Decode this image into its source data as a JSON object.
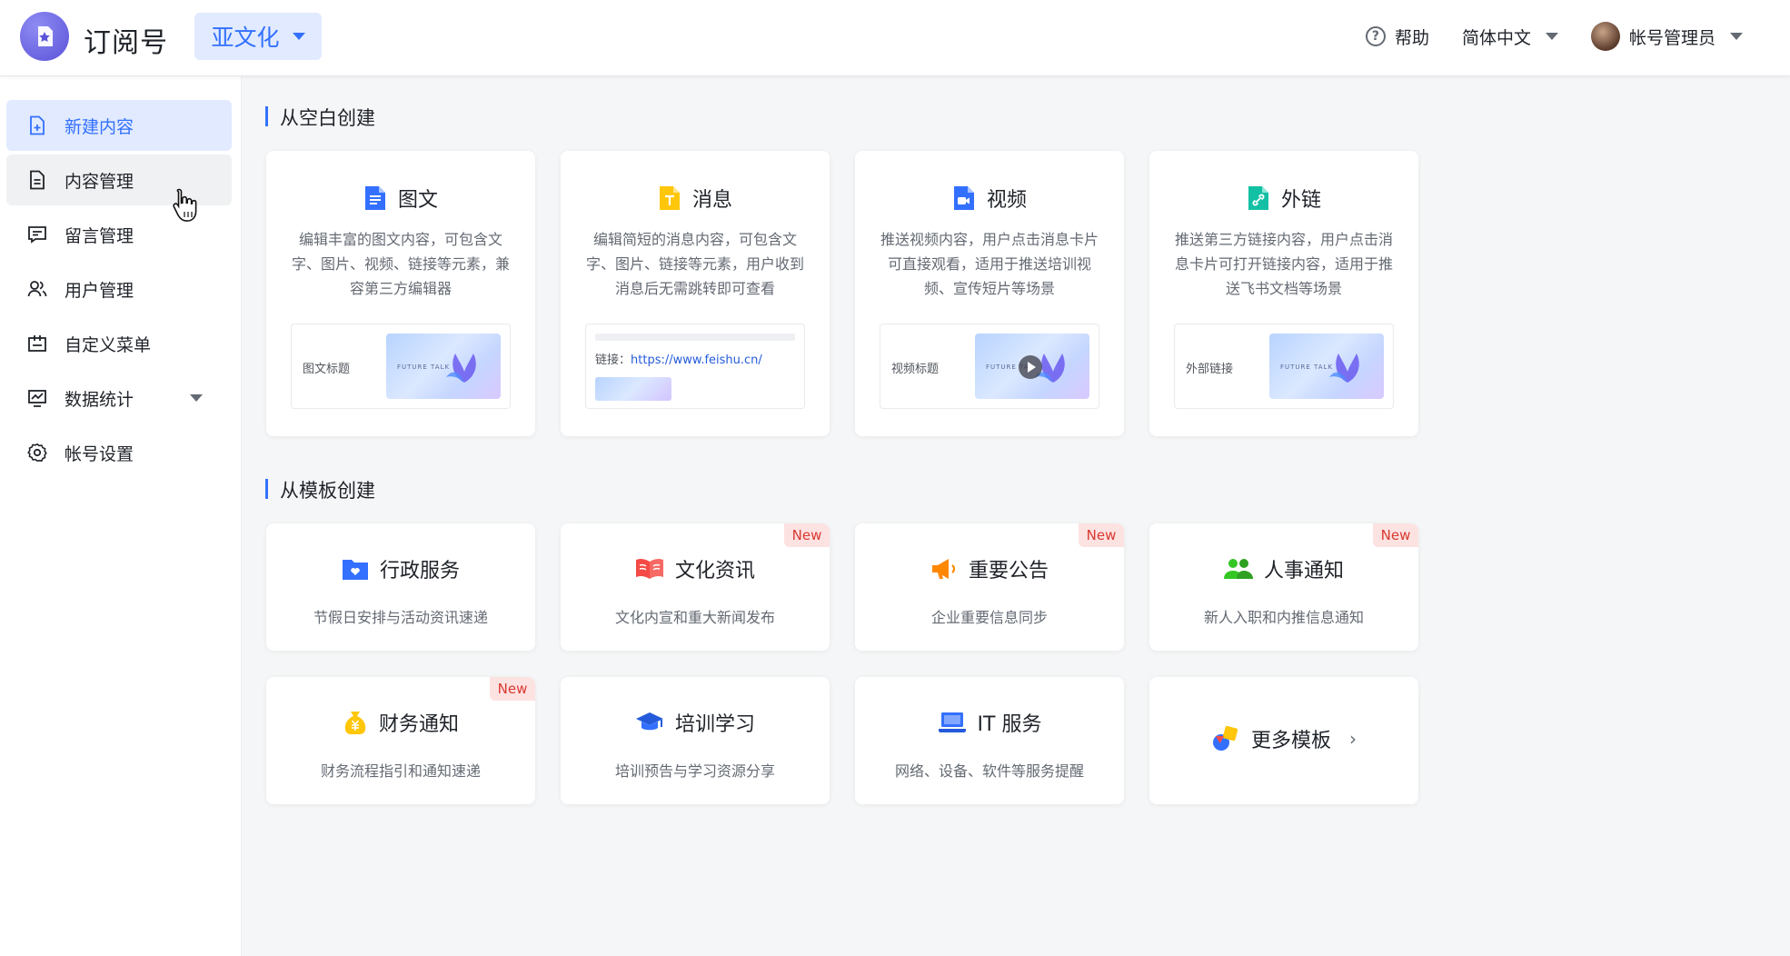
{
  "app": {
    "title": "订阅号",
    "workspace": "亚文化"
  },
  "topbar": {
    "help": "帮助",
    "language": "简体中文",
    "account": "帐号管理员"
  },
  "sidebar": {
    "items": [
      {
        "label": "新建内容",
        "icon": "file-add-icon"
      },
      {
        "label": "内容管理",
        "icon": "document-icon"
      },
      {
        "label": "留言管理",
        "icon": "comment-icon"
      },
      {
        "label": "用户管理",
        "icon": "users-icon"
      },
      {
        "label": "自定义菜单",
        "icon": "menu-icon"
      },
      {
        "label": "数据统计",
        "icon": "chart-icon"
      },
      {
        "label": "帐号设置",
        "icon": "gear-icon"
      }
    ]
  },
  "blank": {
    "title": "从空白创建",
    "cards": [
      {
        "title": "图文",
        "desc": [
          "编辑丰富的图文内容，可包含文",
          "字、图片、视频、链接等元素，兼",
          "容第三方编辑器"
        ],
        "preview_label": "图文标题",
        "thumb_text": "FUTURE TALK"
      },
      {
        "title": "消息",
        "desc": [
          "编辑简短的消息内容，可包含文",
          "字、图片、链接等元素，用户收到",
          "消息后无需跳转即可查看"
        ],
        "link_label": "链接：",
        "link_url": "https://www.feishu.cn/"
      },
      {
        "title": "视频",
        "desc": [
          "推送视频内容，用户点击消息卡片",
          "可直接观看，适用于推送培训视",
          "频、宣传短片等场景"
        ],
        "preview_label": "视频标题",
        "thumb_text": "FUTURE TA"
      },
      {
        "title": "外链",
        "desc": [
          "推送第三方链接内容，用户点击消",
          "息卡片可打开链接内容，适用于推",
          "送飞书文档等场景"
        ],
        "preview_label": "外部链接",
        "thumb_text": "FUTURE TALK"
      }
    ]
  },
  "template": {
    "title": "从模板创建",
    "badge": "New",
    "cards": [
      {
        "title": "行政服务",
        "desc": "节假日安排与活动资讯速递"
      },
      {
        "title": "文化资讯",
        "desc": "文化内宣和重大新闻发布"
      },
      {
        "title": "重要公告",
        "desc": "企业重要信息同步"
      },
      {
        "title": "人事通知",
        "desc": "新人入职和内推信息通知"
      },
      {
        "title": "财务通知",
        "desc": "财务流程指引和通知速递"
      },
      {
        "title": "培训学习",
        "desc": "培训预告与学习资源分享"
      },
      {
        "title": "IT 服务",
        "desc": "网络、设备、软件等服务提醒"
      },
      {
        "title": "更多模板"
      }
    ]
  },
  "colors": {
    "accent": "#3370ff",
    "accent_bg": "#e1eaff",
    "badge_bg": "#fde2e2",
    "badge_text": "#d83931"
  }
}
